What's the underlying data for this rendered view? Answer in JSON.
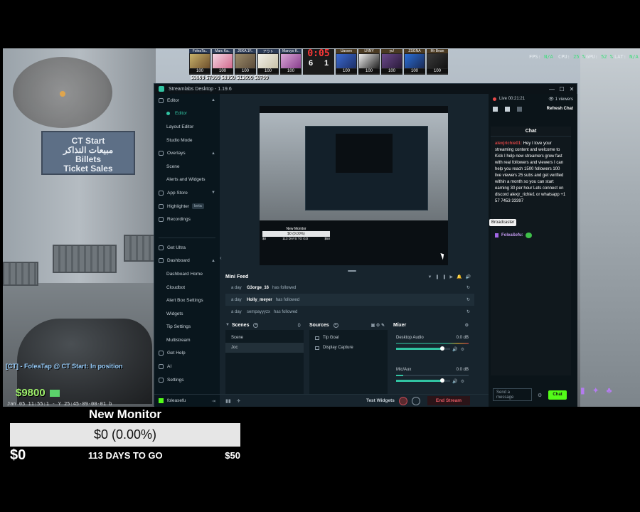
{
  "game": {
    "sign_line1": "CT Start",
    "sign_line2": "مبيعات التذاكر",
    "sign_line3": "Billets",
    "sign_line4": "Ticket Sales",
    "killfeed": "[CT] - FoleaTap @ CT Start: In position",
    "money": "$9800",
    "date": "Jan 05 11:55:1 - Y 25:45-09-00-01 b",
    "fps_label": "FPS:",
    "fps_value": "N/A",
    "cpu_label": "CPU:",
    "cpu_value": "25 %",
    "gpu_label": "GPU:",
    "gpu_value": "52 %",
    "lat_label": "LAT:",
    "lat_value": "N/A"
  },
  "scoreboard": {
    "timer": "0:05",
    "score_left": "6",
    "score_right": "1",
    "left_players": [
      {
        "name": "FoleaTa..",
        "hp": "100"
      },
      {
        "name": "Marc Ka..",
        "hp": "100"
      },
      {
        "name": "JEKA 1F..",
        "hp": "100"
      },
      {
        "name": "アウト",
        "hp": "100"
      },
      {
        "name": "Marcyo K..",
        "hp": "100"
      }
    ],
    "right_players": [
      {
        "name": "Uarsen",
        "hp": "100"
      },
      {
        "name": "LNNY",
        "hp": "100"
      },
      {
        "name": "yu!",
        "hp": "100"
      },
      {
        "name": "ZSGNA",
        "hp": "100"
      },
      {
        "name": "Mr Bean",
        "hp": "100"
      }
    ],
    "money_row": "$9800 $7000 $8950 $13600 $8700"
  },
  "window": {
    "title": "Streamlabs Desktop - 1.19.6",
    "minimize": "—",
    "maximize": "☐",
    "close": "✕"
  },
  "sidebar": {
    "editor": "Editor",
    "editor_sub": "Editor",
    "layout_editor": "Layout Editor",
    "studio_mode": "Studio Mode",
    "overlays": "Overlays",
    "scene": "Scene",
    "alerts_widgets": "Alerts and Widgets",
    "app_store": "App Store",
    "highlighter": "Highlighter",
    "beta": "beta",
    "recordings": "Recordings",
    "get_ultra": "Get Ultra",
    "dashboard": "Dashboard",
    "dashboard_home": "Dashboard Home",
    "cloudbot": "Cloudbot",
    "alert_box": "Alert Box Settings",
    "widgets": "Widgets",
    "tip_settings": "Tip Settings",
    "multistream": "Multistream",
    "get_help": "Get Help",
    "ai": "AI",
    "settings": "Settings",
    "user": "foleasefu"
  },
  "preview": {
    "goal_title": "New Monitor",
    "goal_bar": "$0 (0.00%)",
    "goal_left": "$0",
    "goal_mid": "113 DAYS TO GO",
    "goal_right": "$50"
  },
  "minifeed": {
    "title": "Mini Feed",
    "items": [
      {
        "ago": "a day",
        "user": "G3orge_16",
        "action": "has followed"
      },
      {
        "ago": "a day",
        "user": "Holly_meyer",
        "action": "has followed"
      },
      {
        "ago": "a day",
        "user": "sempayyyzx",
        "action": "has followed"
      }
    ]
  },
  "scenes": {
    "title": "Scenes",
    "items": [
      "Scene",
      "Joc"
    ]
  },
  "sources": {
    "title": "Sources",
    "items": [
      "Tip Goal",
      "Display Capture"
    ]
  },
  "mixer": {
    "title": "Mixer",
    "channels": [
      {
        "name": "Desktop Audio",
        "db": "0.0 dB",
        "level": 0.85
      },
      {
        "name": "Mic/Aux",
        "db": "0.0 dB",
        "level": 0.85
      }
    ]
  },
  "footer": {
    "test_widgets": "Test Widgets",
    "end_stream": "End Stream"
  },
  "chat": {
    "live": "Live",
    "live_time": "00:21:21",
    "viewers": "1 viewers",
    "refresh": "Refresh Chat",
    "title": "Chat",
    "msg1_user": "alexjrichie01:",
    "msg1_text": "Hey I love your streaming content and welcome to Kick I help new streamers grow fast with real followers and viewers I can help you reach 1500 followers 100 live viewers 25 subs and get verified within a month so you can start earning 30 per hour Lets connect on discord alexjr_richie1 or whatsapp +1 57 7453 33397",
    "broadcaster": "Broadcaster",
    "msg2_user": "FoleaSefu:",
    "input_placeholder": "Send a message",
    "send": "Chat"
  },
  "goal_overlay": {
    "title": "New Monitor",
    "bar_text": "$0 (0.00%)",
    "progress": 0.0,
    "left": "$0",
    "middle": "113 DAYS TO GO",
    "right": "$50"
  }
}
